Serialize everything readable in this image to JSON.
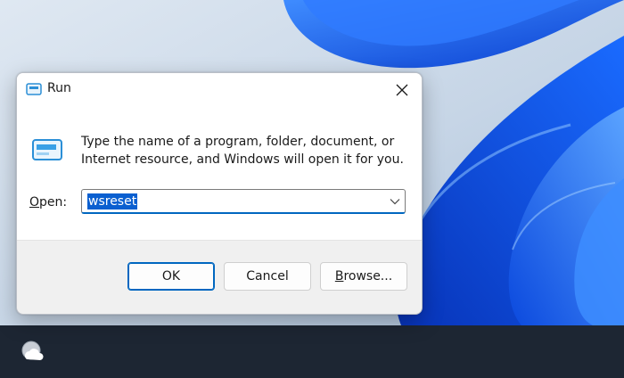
{
  "dialog": {
    "title": "Run",
    "description": "Type the name of a program, folder, document, or Internet resource, and Windows will open it for you.",
    "open_label_accesskey": "O",
    "open_label_rest": "pen:",
    "input_value": "wsreset",
    "buttons": {
      "ok": "OK",
      "cancel": "Cancel",
      "browse_accesskey": "B",
      "browse_rest": "rowse..."
    }
  },
  "icons": {
    "title": "run-app-icon",
    "content": "run-app-icon",
    "close": "close-icon",
    "dropdown": "chevron-down-icon",
    "taskbar": "weather-icon"
  },
  "colors": {
    "accent": "#0067c0",
    "selection": "#0a5fd0",
    "taskbar": "#1d2633",
    "wallpaper_blue": "#0a5fe0"
  }
}
